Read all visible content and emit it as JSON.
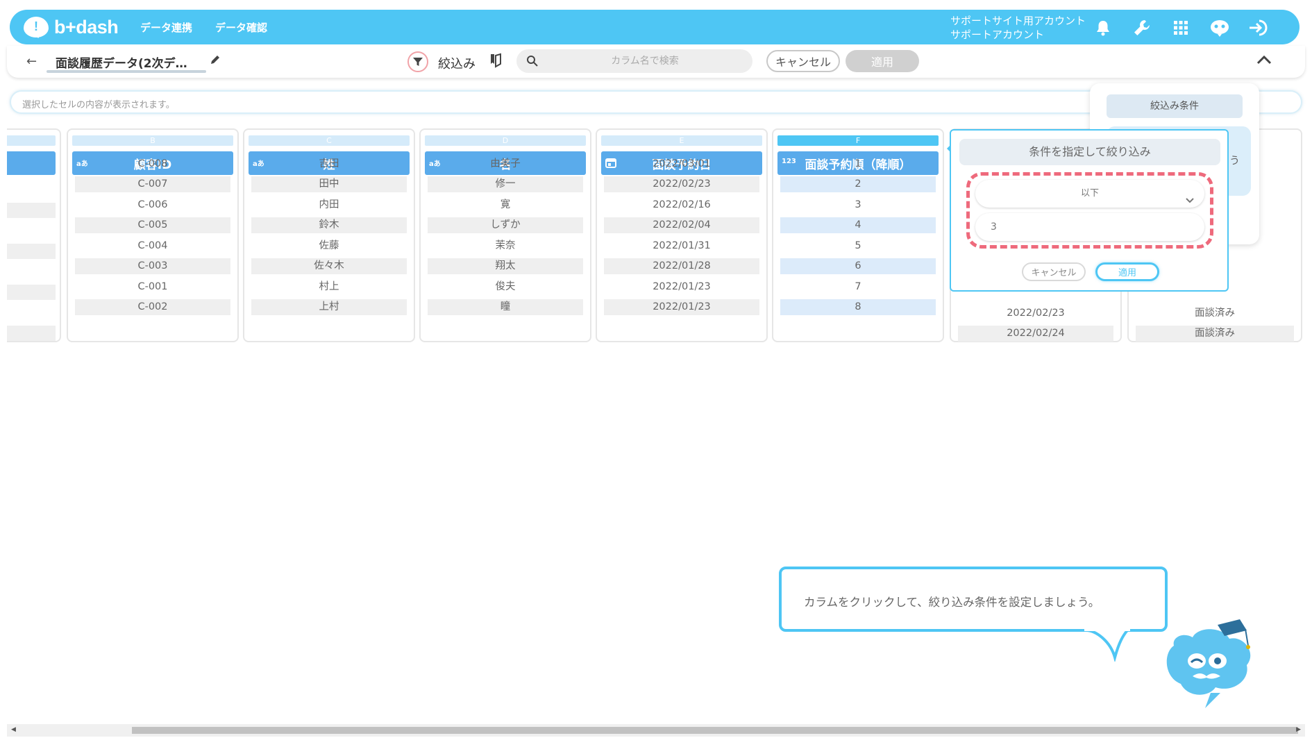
{
  "header": {
    "logo_text": "b+dash",
    "nav": [
      "データ連携",
      "データ確認"
    ],
    "account_line1": "サポートサイト用アカウント",
    "account_line2": "サポートアカウント"
  },
  "toolbar": {
    "title": "面談履歴データ(2次デ…",
    "filter_label": "絞込み",
    "search_placeholder": "カラム名で検索",
    "cancel_label": "キャンセル",
    "apply_label": "適用"
  },
  "cell_bar": {
    "placeholder": "選択したセルの内容が表示されます。"
  },
  "columns": [
    {
      "letter": "B",
      "type": "aあ",
      "name": "顧客ID",
      "values": [
        "C-008",
        "C-007",
        "C-006",
        "C-005",
        "C-004",
        "C-003",
        "C-001",
        "C-002"
      ]
    },
    {
      "letter": "C",
      "type": "aあ",
      "name": "姓",
      "values": [
        "吉田",
        "田中",
        "内田",
        "鈴木",
        "佐藤",
        "佐々木",
        "村上",
        "上村"
      ]
    },
    {
      "letter": "D",
      "type": "aあ",
      "name": "名",
      "values": [
        "由美子",
        "修一",
        "寛",
        "しずか",
        "茉奈",
        "翔太",
        "俊夫",
        "瞳"
      ]
    },
    {
      "letter": "E",
      "type": "calendar",
      "name": "面談予約日",
      "values": [
        "2022/03/01",
        "2022/02/23",
        "2022/02/16",
        "2022/02/04",
        "2022/01/31",
        "2022/01/28",
        "2022/01/23",
        "2022/01/23"
      ]
    },
    {
      "letter": "F",
      "type": "123",
      "name": "面談予約順（降順）",
      "values": [
        "1",
        "2",
        "3",
        "4",
        "5",
        "6",
        "7",
        "8"
      ]
    }
  ],
  "partial_columns": {
    "g_visible_values": [
      "2022/02/23",
      "2022/02/24"
    ],
    "h_visible_values": [
      "面談済み",
      "面談済み"
    ]
  },
  "filter_popover": {
    "title": "条件を指定して絞り込み",
    "operator": "以下",
    "value": "3",
    "cancel_label": "キャンセル",
    "apply_label": "適用"
  },
  "filter_panel": {
    "title": "絞込み条件",
    "hint_fragment": "う"
  },
  "tutorial": {
    "message": "カラムをクリックして、絞り込み条件を設定しましょう。"
  },
  "colors": {
    "brand": "#4ec6f4",
    "header_blue": "#5aabeb",
    "highlight_red": "#ee6a7c"
  }
}
